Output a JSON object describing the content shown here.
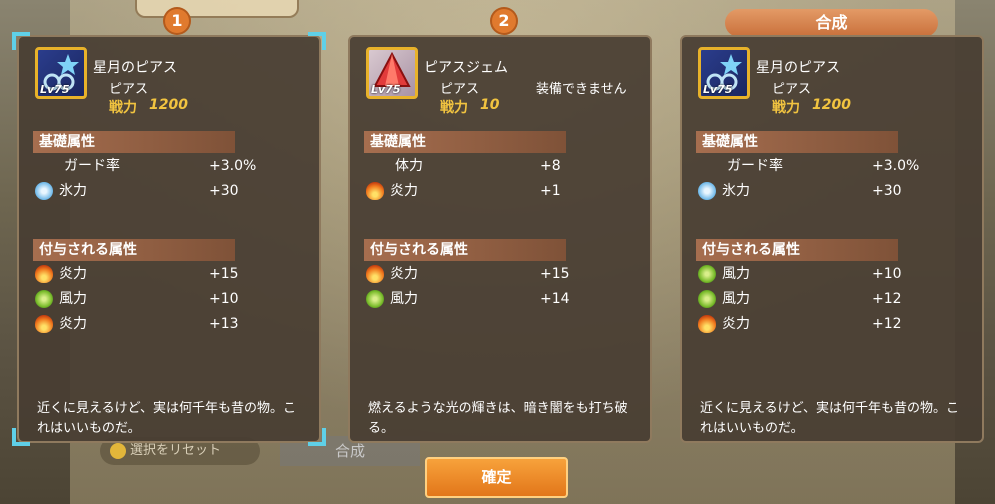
{
  "badges": {
    "first": "1",
    "second": "2"
  },
  "result_header": "合成",
  "panels": [
    {
      "item_name": "星月のピアス",
      "item_type": "ピアス",
      "equip_note": "",
      "level": "Lv75",
      "power_label": "戦力",
      "power_value": "1200",
      "base_header": "基礎属性",
      "base_stats": [
        {
          "icon": "none",
          "name": "ガード率",
          "value": "+3.0%"
        },
        {
          "icon": "ice-icon",
          "name": "氷力",
          "value": "+30"
        }
      ],
      "grant_header": "付与される属性",
      "grant_stats": [
        {
          "icon": "fire-icon",
          "name": "炎力",
          "value": "+15"
        },
        {
          "icon": "wind-icon",
          "name": "風力",
          "value": "+10"
        },
        {
          "icon": "fire-icon",
          "name": "炎力",
          "value": "+13"
        }
      ],
      "description": "近くに見えるけど、実は何千年も昔の物。これはいいものだ。"
    },
    {
      "item_name": "ピアスジェム",
      "item_type": "ピアス",
      "equip_note": "装備できません",
      "level": "Lv75",
      "power_label": "戦力",
      "power_value": "10",
      "base_header": "基礎属性",
      "base_stats": [
        {
          "icon": "none",
          "name": "体力",
          "value": "+8"
        },
        {
          "icon": "fire-icon",
          "name": "炎力",
          "value": "+1"
        }
      ],
      "grant_header": "付与される属性",
      "grant_stats": [
        {
          "icon": "fire-icon",
          "name": "炎力",
          "value": "+15"
        },
        {
          "icon": "wind-icon",
          "name": "風力",
          "value": "+14"
        }
      ],
      "description": "燃えるような光の輝きは、暗き闇をも打ち破る。"
    },
    {
      "item_name": "星月のピアス",
      "item_type": "ピアス",
      "equip_note": "",
      "level": "Lv75",
      "power_label": "戦力",
      "power_value": "1200",
      "base_header": "基礎属性",
      "base_stats": [
        {
          "icon": "none",
          "name": "ガード率",
          "value": "+3.0%"
        },
        {
          "icon": "ice-icon",
          "name": "氷力",
          "value": "+30"
        }
      ],
      "grant_header": "付与される属性",
      "grant_stats": [
        {
          "icon": "wind-icon",
          "name": "風力",
          "value": "+10"
        },
        {
          "icon": "wind-icon",
          "name": "風力",
          "value": "+12"
        },
        {
          "icon": "fire-icon",
          "name": "炎力",
          "value": "+12"
        }
      ],
      "description": "近くに見えるけど、実は何千年も昔の物。これはいいものだ。"
    }
  ],
  "background": {
    "reset_label": "選択をリセット",
    "gosei_label": "合成"
  },
  "confirm_label": "確定"
}
